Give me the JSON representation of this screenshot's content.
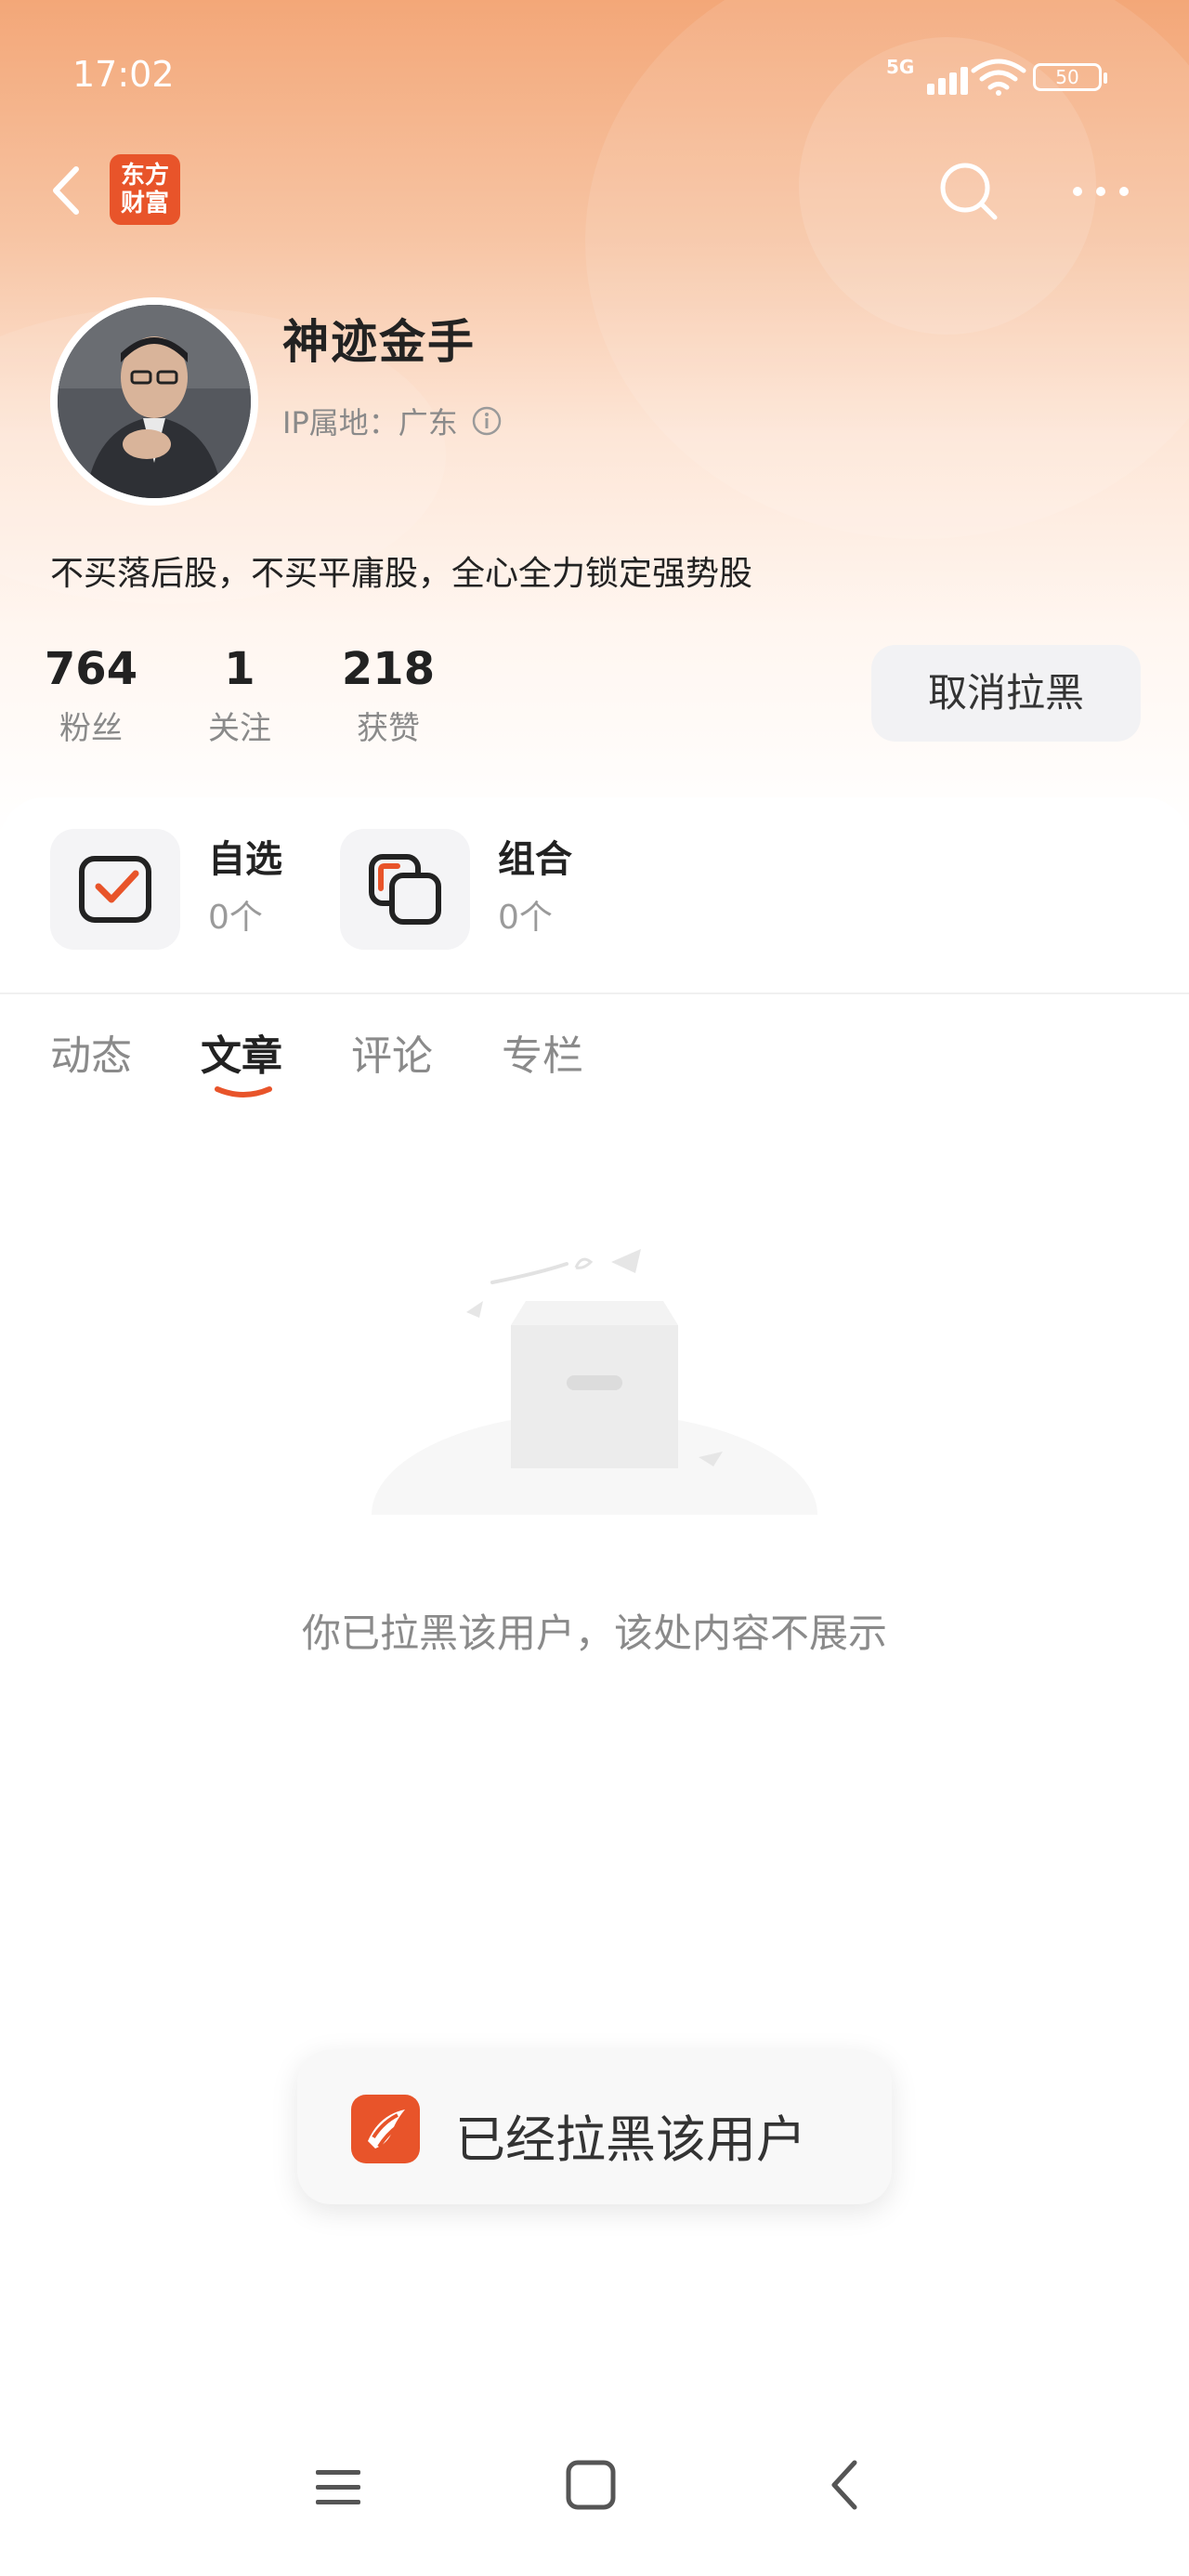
{
  "status_bar": {
    "time": "17:02",
    "network": "5G",
    "battery": "50"
  },
  "nav": {
    "logo_line1": "东方",
    "logo_line2": "财富"
  },
  "profile": {
    "username": "神迹金手",
    "ip_location": "IP属地：广东",
    "bio": "不买落后股，不买平庸股，全心全力锁定强势股",
    "stats": [
      {
        "value": "764",
        "label": "粉丝"
      },
      {
        "value": "1",
        "label": "关注"
      },
      {
        "value": "218",
        "label": "获赞"
      }
    ],
    "unblock_label": "取消拉黑"
  },
  "favorites": [
    {
      "title": "自选",
      "count": "0个",
      "icon": "checkbox-icon"
    },
    {
      "title": "组合",
      "count": "0个",
      "icon": "overlap-squares-icon"
    }
  ],
  "tabs": [
    {
      "label": "动态",
      "active": false
    },
    {
      "label": "文章",
      "active": true
    },
    {
      "label": "评论",
      "active": false
    },
    {
      "label": "专栏",
      "active": false
    }
  ],
  "empty_state": {
    "message": "你已拉黑该用户，该处内容不展示"
  },
  "toast": {
    "message": "已经拉黑该用户"
  },
  "colors": {
    "accent": "#e8542a",
    "header_gradient_top": "#f3a778"
  }
}
